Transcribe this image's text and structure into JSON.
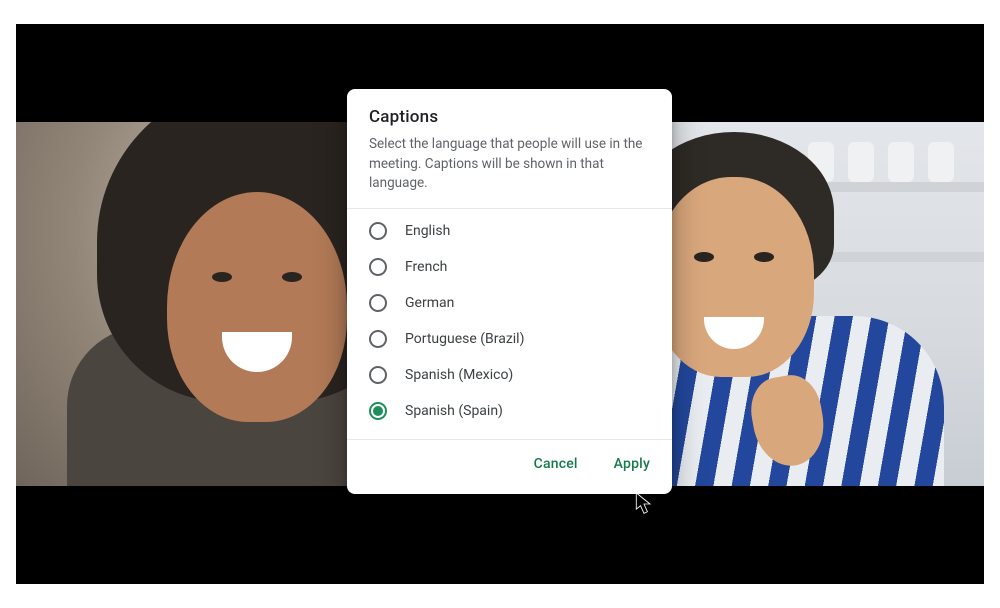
{
  "dialog": {
    "title": "Captions",
    "description": "Select the language that people will use in the meeting. Captions will be shown in that language.",
    "options": [
      {
        "label": "English",
        "selected": false
      },
      {
        "label": "French",
        "selected": false
      },
      {
        "label": "German",
        "selected": false
      },
      {
        "label": "Portuguese (Brazil)",
        "selected": false
      },
      {
        "label": "Spanish (Mexico)",
        "selected": false
      },
      {
        "label": "Spanish (Spain)",
        "selected": true
      }
    ],
    "actions": {
      "cancel": "Cancel",
      "apply": "Apply"
    }
  },
  "colors": {
    "accent": "#1e8e5a",
    "text_primary": "#202124",
    "text_secondary": "#5f6368"
  }
}
